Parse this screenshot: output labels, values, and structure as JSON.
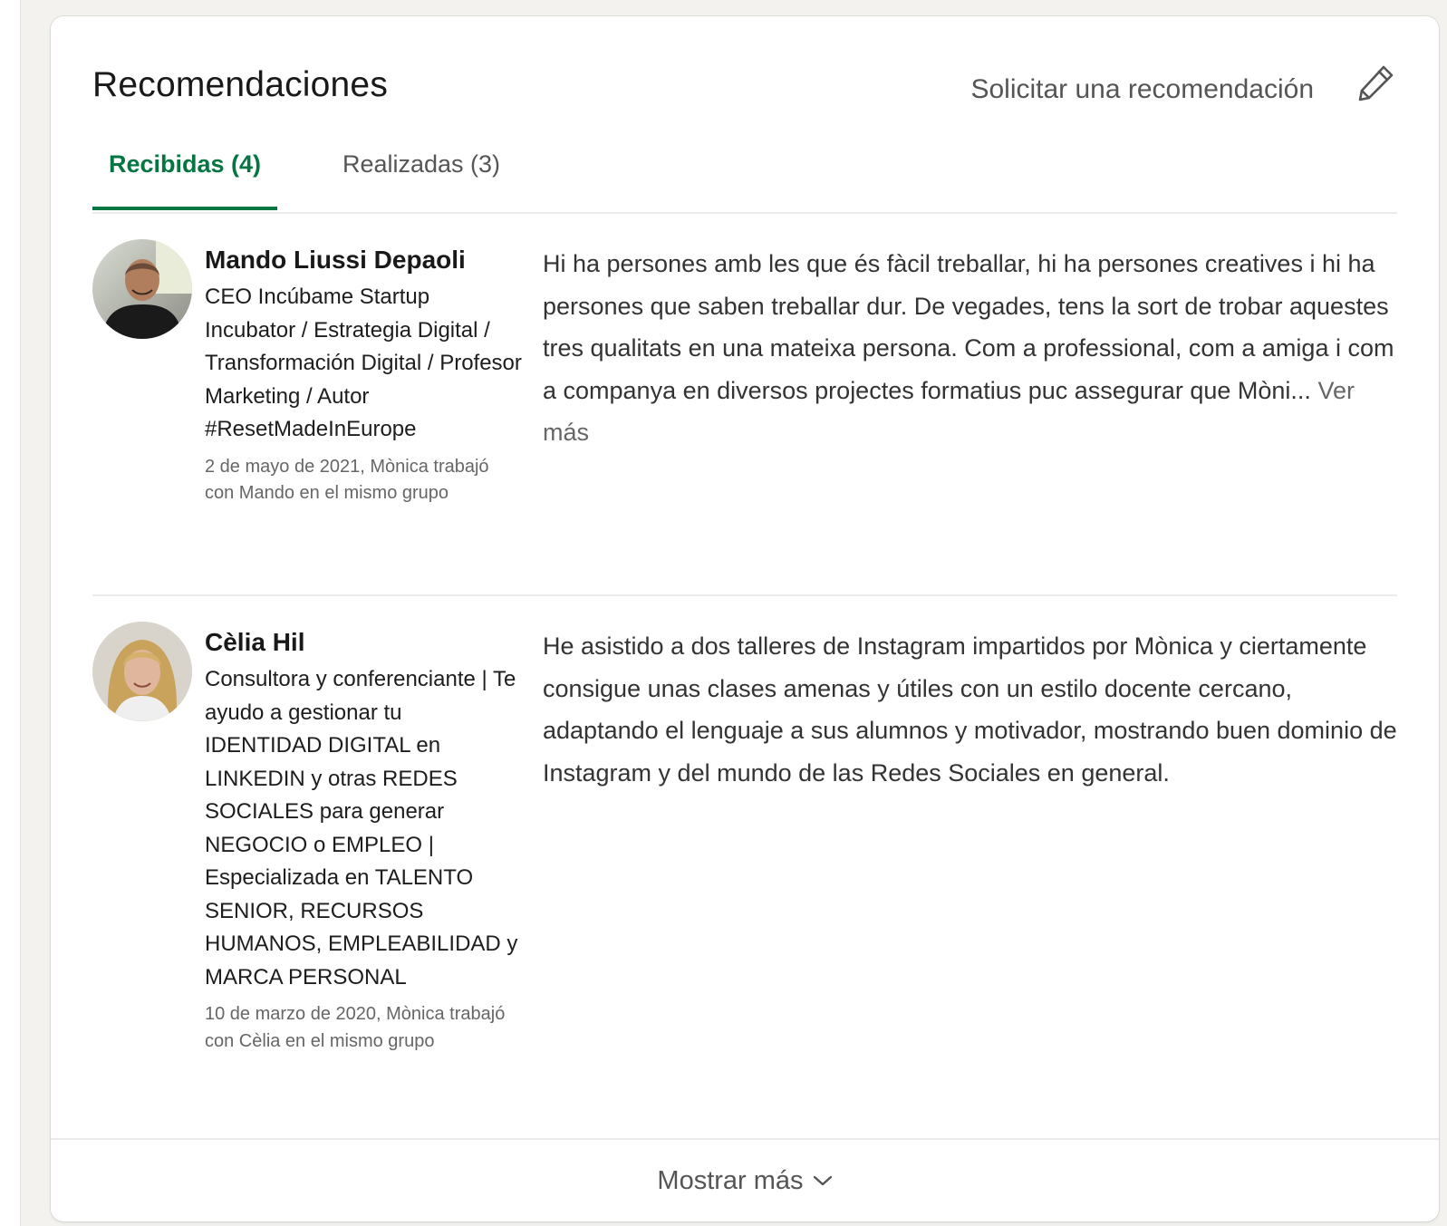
{
  "section": {
    "title": "Recomendaciones",
    "request_label": "Solicitar una recomendación",
    "edit_icon": "pencil-icon"
  },
  "tabs": [
    {
      "label": "Recibidas (4)",
      "selected": true
    },
    {
      "label": "Realizadas (3)",
      "selected": false
    }
  ],
  "recommendations": [
    {
      "name": "Mando Liussi Depaoli",
      "headline": "CEO Incúbame Startup Incubator / Estrategia Digital / Transformación Digital / Profesor Marketing / Autor #ResetMadeInEurope",
      "meta": "2 de mayo de 2021, Mònica trabajó con Mando en el mismo grupo",
      "text": "Hi ha persones amb les que és fàcil treballar, hi ha persones creatives i hi ha persones que saben treballar dur. De vegades, tens la sort de trobar aquestes tres qualitats en una mateixa persona. Com a professional, com a amiga i com a companya en diversos projectes formatius puc assegurar que Mòni...",
      "see_more": "Ver más"
    },
    {
      "name": "Cèlia Hil",
      "headline": "Consultora y conferenciante | Te ayudo a gestionar tu IDENTIDAD DIGITAL en LINKEDIN y otras REDES SOCIALES para generar NEGOCIO o EMPLEO | Especializada en TALENTO SENIOR, RECURSOS HUMANOS, EMPLEABILIDAD y MARCA PERSONAL",
      "meta": "10 de marzo de 2020, Mònica trabajó con Cèlia en el mismo grupo",
      "text": "He asistido a dos talleres de Instagram impartidos por Mònica y ciertamente consigue unas clases amenas y útiles con un estilo docente cercano, adaptando el lenguaje a sus alumnos y motivador, mostrando buen dominio de Instagram y del mundo de las Redes Sociales en general."
    }
  ],
  "footer": {
    "show_more_label": "Mostrar más",
    "icon": "chevron-down-icon"
  },
  "colors": {
    "accent": "#057642",
    "background": "#f3f2ef",
    "card": "#ffffff"
  }
}
